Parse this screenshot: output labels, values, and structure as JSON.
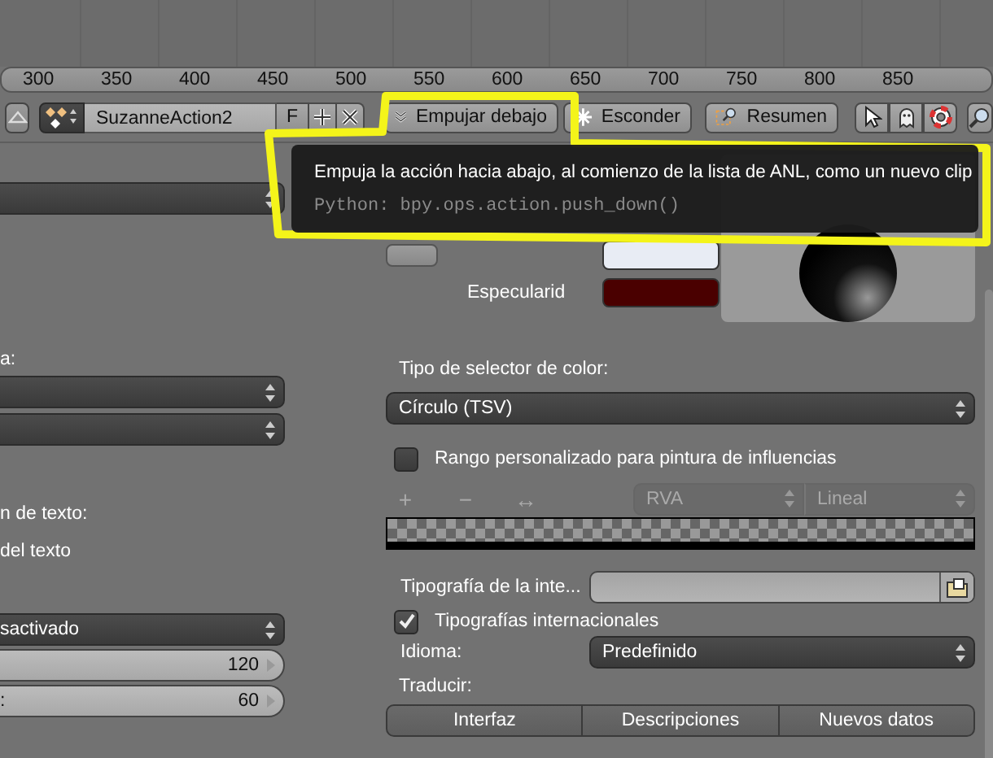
{
  "ruler": {
    "ticks": [
      "300",
      "350",
      "400",
      "450",
      "500",
      "550",
      "600",
      "650",
      "700",
      "750",
      "800",
      "850"
    ]
  },
  "header": {
    "action_name": "SuzanneAction2",
    "fake_user_label": "F",
    "buttons": [
      {
        "label": "Empujar debajo",
        "kind": "push"
      },
      {
        "label": "Esconder",
        "kind": "stash"
      },
      {
        "label": "Resumen",
        "kind": "summary"
      }
    ]
  },
  "tooltip": {
    "description": "Empuja la acción hacia abajo, al comienzo de la lista de ANL, como un nuevo clip",
    "python": "Python: bpy.ops.action.push_down()"
  },
  "left_panel": {
    "sections": [
      {
        "items": [
          {
            "kind": "dropdown"
          }
        ]
      },
      {
        "items": [
          {
            "kind": "label",
            "text": "a:"
          },
          {
            "kind": "dropdown"
          },
          {
            "kind": "dropdown"
          }
        ]
      },
      {
        "items": [
          {
            "kind": "label",
            "text": "n de texto:"
          },
          {
            "kind": "label",
            "text": "del texto"
          }
        ]
      },
      {
        "items": [
          {
            "kind": "dropdown",
            "value": "sactivado"
          },
          {
            "kind": "slider",
            "value": "120"
          },
          {
            "kind": "slider",
            "label": ":",
            "value": "60"
          }
        ]
      }
    ]
  },
  "right_panel": {
    "swatches": [
      {
        "color": "#e8ecf4"
      },
      {
        "label": "Especularid",
        "color": "#4a0000"
      }
    ],
    "picker_type": {
      "label": "Tipo de selector de color:",
      "value": "Círculo (TSV)"
    },
    "weight_range": {
      "label": "Rango personalizado para pintura de influencias",
      "checked": false,
      "tools": [
        "+",
        "−",
        "↔"
      ],
      "color_mode": "RVA",
      "interpolation": "Lineal"
    },
    "font_field": {
      "label": "Tipografía de la inte..."
    },
    "international_fonts": {
      "label": "Tipografías internacionales",
      "checked": true
    },
    "language": {
      "label": "Idioma:",
      "value": "Predefinido"
    },
    "translate": {
      "label": "Traducir:",
      "buttons": [
        "Interfaz",
        "Descripciones",
        "Nuevos datos"
      ]
    }
  }
}
